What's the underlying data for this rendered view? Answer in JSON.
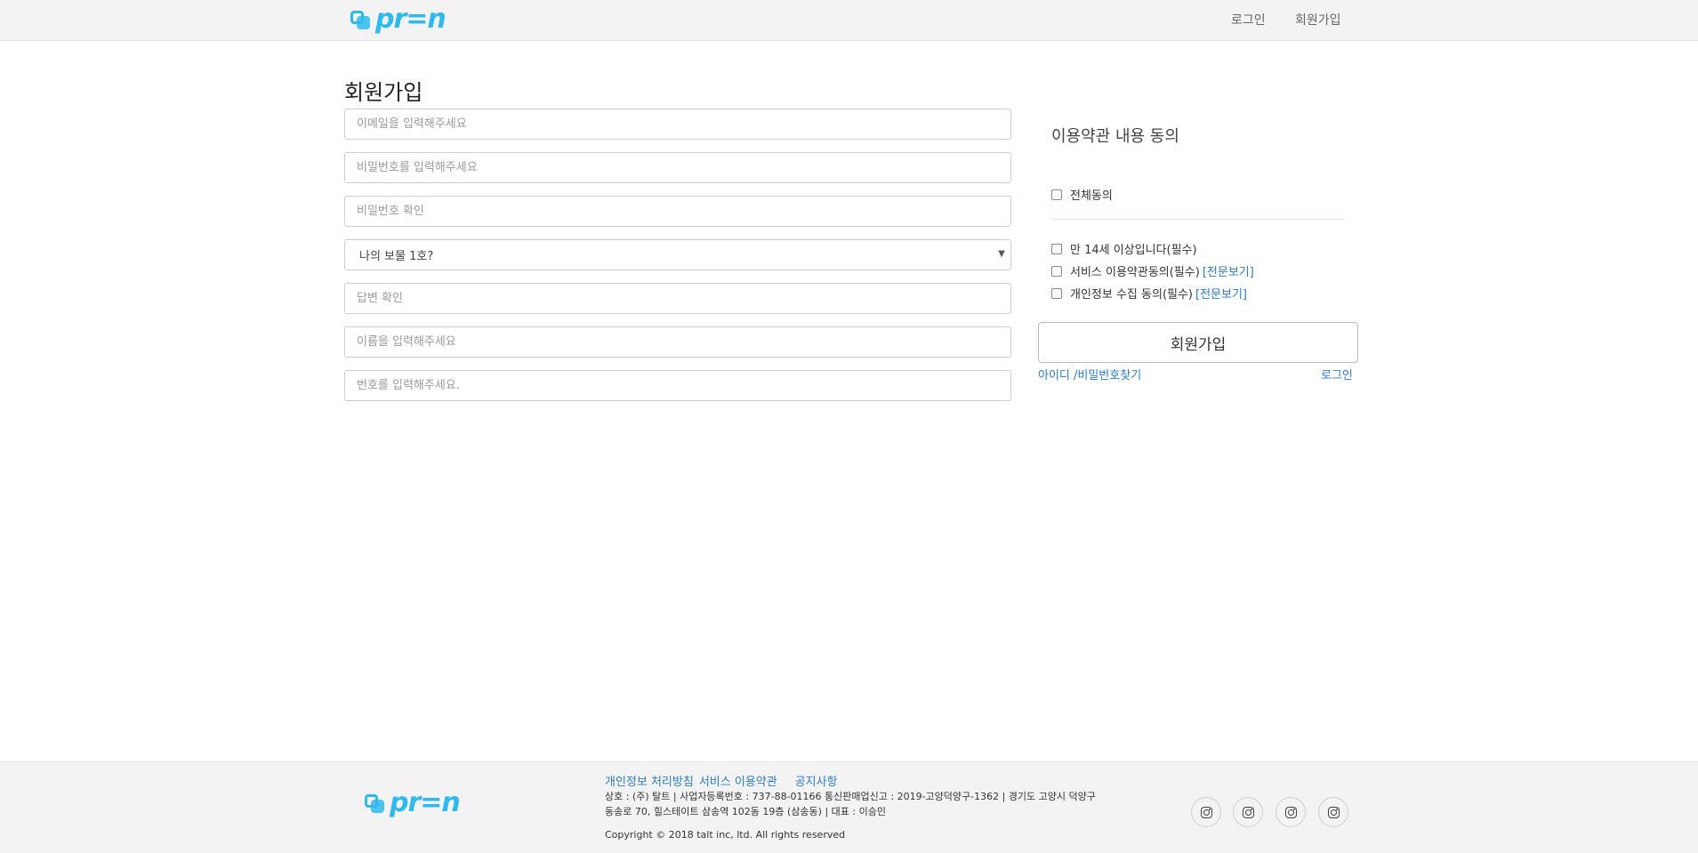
{
  "brand": {
    "logo_text": "pr=n",
    "color": "#2ebaf0"
  },
  "header": {
    "nav": {
      "login": "로그인",
      "signup": "회원가입"
    }
  },
  "page": {
    "title": "회원가입"
  },
  "form": {
    "email_placeholder": "이메일을 입력해주세요",
    "password_placeholder": "비밀번호를 입력해주세요",
    "password_confirm_placeholder": "비밀번호 확인",
    "security_question_selected": "나의 보물 1호?",
    "answer_placeholder": "답변 확인",
    "name_placeholder": "이름을 입력해주세요",
    "phone_placeholder": "번호를 입력해주세요."
  },
  "terms": {
    "title": "이용약관 내용 동의",
    "agree_all": "전체동의",
    "items": [
      {
        "label": "만 14세 이상입니다(필수)",
        "link": ""
      },
      {
        "label": "서비스 이용약관동의(필수)",
        "link": "[전문보기]"
      },
      {
        "label": "개인정보 수집 동의(필수)",
        "link": "[전문보기]"
      }
    ],
    "submit_label": "회원가입",
    "find_account": "아이디 /비밀번호찾기",
    "login_link": "로그인",
    "link_color": "#2d7cc4"
  },
  "footer": {
    "links": {
      "privacy": "개인정보 처리방침",
      "terms": "서비스 이용약관",
      "notice": "공지사항"
    },
    "company_info": "상호 : (주) 탈트 | 사업자등록번호 : 737-88-01166 통신판매업신고 : 2019-고양덕양구-1362 | 경기도 고양시 덕양구 동송로 70, 힐스테이트 삼송역 102동 19층 (삼송동) | 대표 : 이승민",
    "copyright": "Copyright © 2018 talt inc, ltd. All rights reserved",
    "social_icons": [
      "instagram-icon",
      "instagram-icon",
      "instagram-icon",
      "instagram-icon"
    ]
  }
}
